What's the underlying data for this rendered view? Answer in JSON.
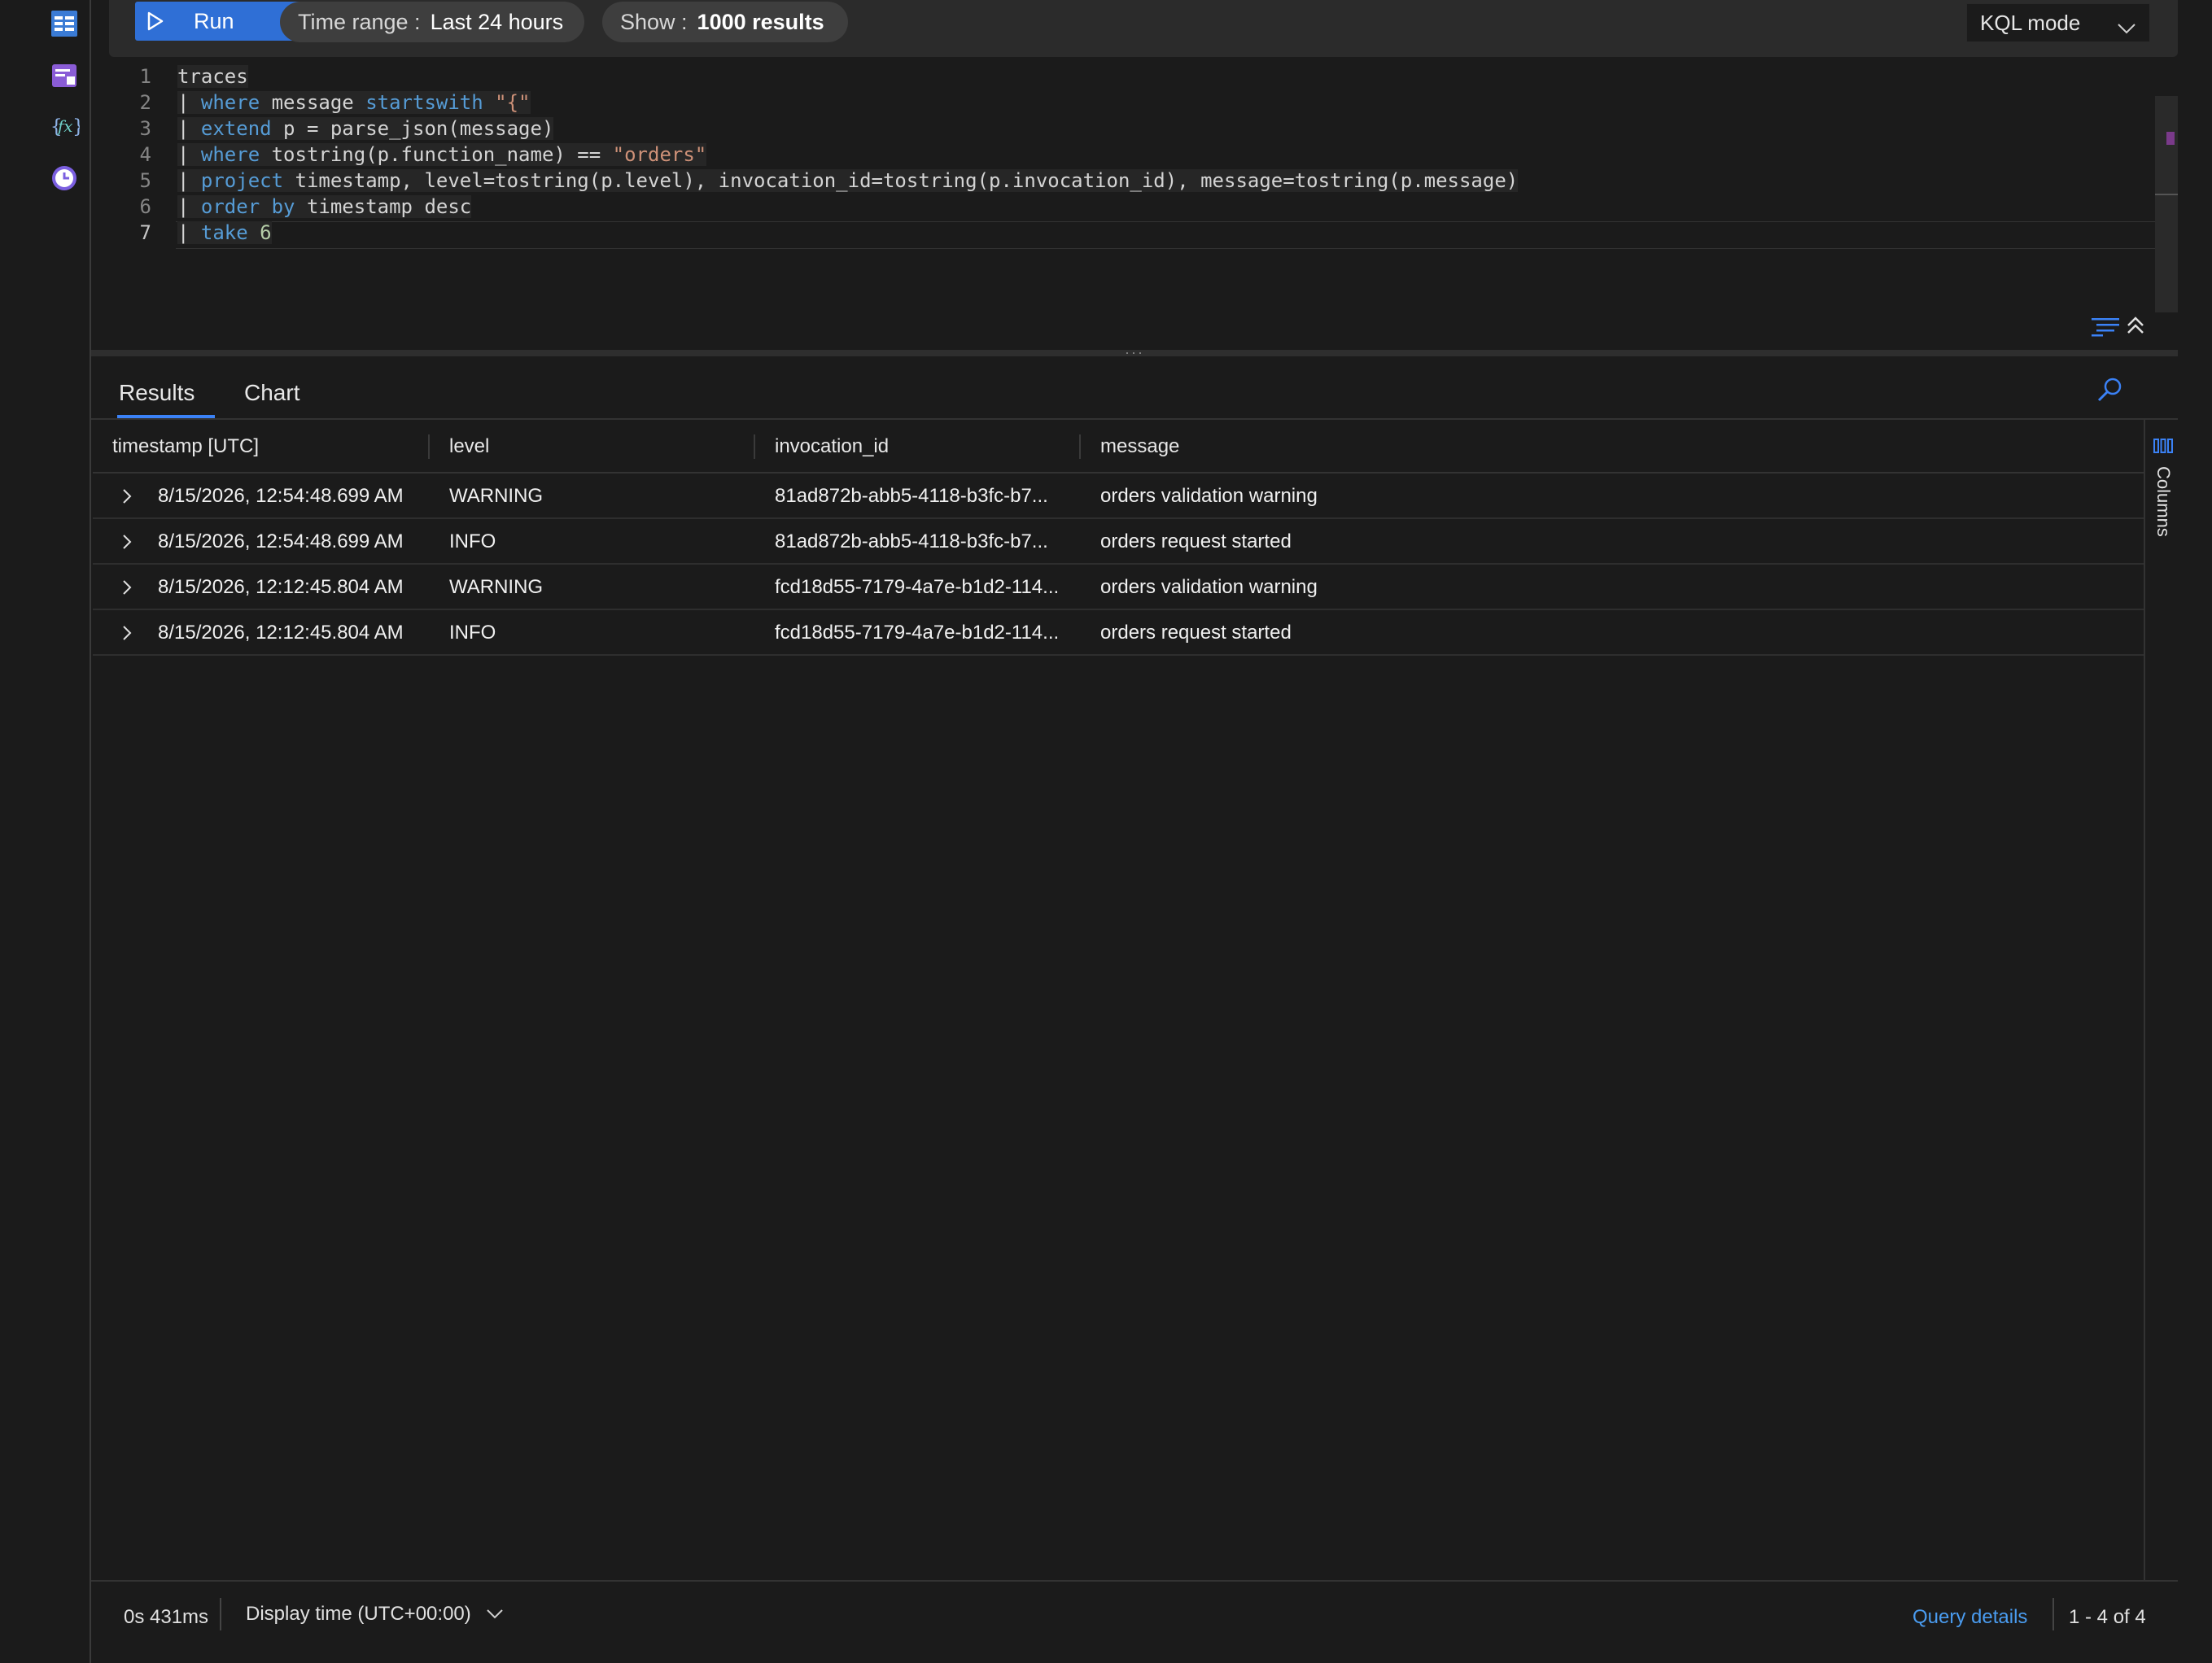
{
  "toolbar": {
    "run_label": "Run",
    "time_range_label": "Time range :",
    "time_range_value": "Last 24 hours",
    "show_label": "Show :",
    "show_value": "1000 results",
    "mode_value": "KQL mode"
  },
  "editor": {
    "active_line": 7,
    "lines": [
      {
        "n": "1",
        "parts": [
          {
            "t": "traces",
            "c": "plain"
          }
        ]
      },
      {
        "n": "2",
        "parts": [
          {
            "t": "| ",
            "c": "plain"
          },
          {
            "t": "where",
            "c": "kw"
          },
          {
            "t": " message ",
            "c": "plain"
          },
          {
            "t": "startswith",
            "c": "kw"
          },
          {
            "t": " ",
            "c": "plain"
          },
          {
            "t": "\"{\"",
            "c": "str"
          }
        ]
      },
      {
        "n": "3",
        "parts": [
          {
            "t": "| ",
            "c": "plain"
          },
          {
            "t": "extend",
            "c": "kw"
          },
          {
            "t": " p = parse_json(message)",
            "c": "plain"
          }
        ]
      },
      {
        "n": "4",
        "parts": [
          {
            "t": "| ",
            "c": "plain"
          },
          {
            "t": "where",
            "c": "kw"
          },
          {
            "t": " tostring(p.function_name) == ",
            "c": "plain"
          },
          {
            "t": "\"orders\"",
            "c": "str"
          }
        ]
      },
      {
        "n": "5",
        "parts": [
          {
            "t": "| ",
            "c": "plain"
          },
          {
            "t": "project",
            "c": "kw"
          },
          {
            "t": " timestamp, level=tostring(p.level), invocation_id=tostring(p.invocation_id), message=tostring(p.message)",
            "c": "plain"
          }
        ]
      },
      {
        "n": "6",
        "parts": [
          {
            "t": "| ",
            "c": "plain"
          },
          {
            "t": "order by",
            "c": "kw"
          },
          {
            "t": " timestamp desc",
            "c": "plain"
          }
        ]
      },
      {
        "n": "7",
        "parts": [
          {
            "t": "| ",
            "c": "plain"
          },
          {
            "t": "take",
            "c": "kw"
          },
          {
            "t": " ",
            "c": "plain"
          },
          {
            "t": "6",
            "c": "num"
          }
        ]
      }
    ]
  },
  "results": {
    "tabs": [
      {
        "label": "Results",
        "active": true
      },
      {
        "label": "Chart",
        "active": false
      }
    ],
    "columns": [
      "timestamp [UTC]",
      "level",
      "invocation_id",
      "message"
    ],
    "rows": [
      [
        "8/15/2026, 12:54:48.699 AM",
        "WARNING",
        "81ad872b-abb5-4118-b3fc-b7...",
        "orders validation warning"
      ],
      [
        "8/15/2026, 12:54:48.699 AM",
        "INFO",
        "81ad872b-abb5-4118-b3fc-b7...",
        "orders request started"
      ],
      [
        "8/15/2026, 12:12:45.804 AM",
        "WARNING",
        "fcd18d55-7179-4a7e-b1d2-114...",
        "orders validation warning"
      ],
      [
        "8/15/2026, 12:12:45.804 AM",
        "INFO",
        "fcd18d55-7179-4a7e-b1d2-114...",
        "orders request started"
      ]
    ],
    "columns_panel_label": "Columns"
  },
  "status": {
    "elapsed": "0s 431ms",
    "display_time": "Display time (UTC+00:00)",
    "query_details": "Query details",
    "count": "1 - 4 of 4"
  },
  "colors": {
    "accent": "#2f6fd6",
    "link": "#4a9cf0",
    "keyword": "#569cd6",
    "string": "#ce9178",
    "number": "#b5cea8"
  }
}
